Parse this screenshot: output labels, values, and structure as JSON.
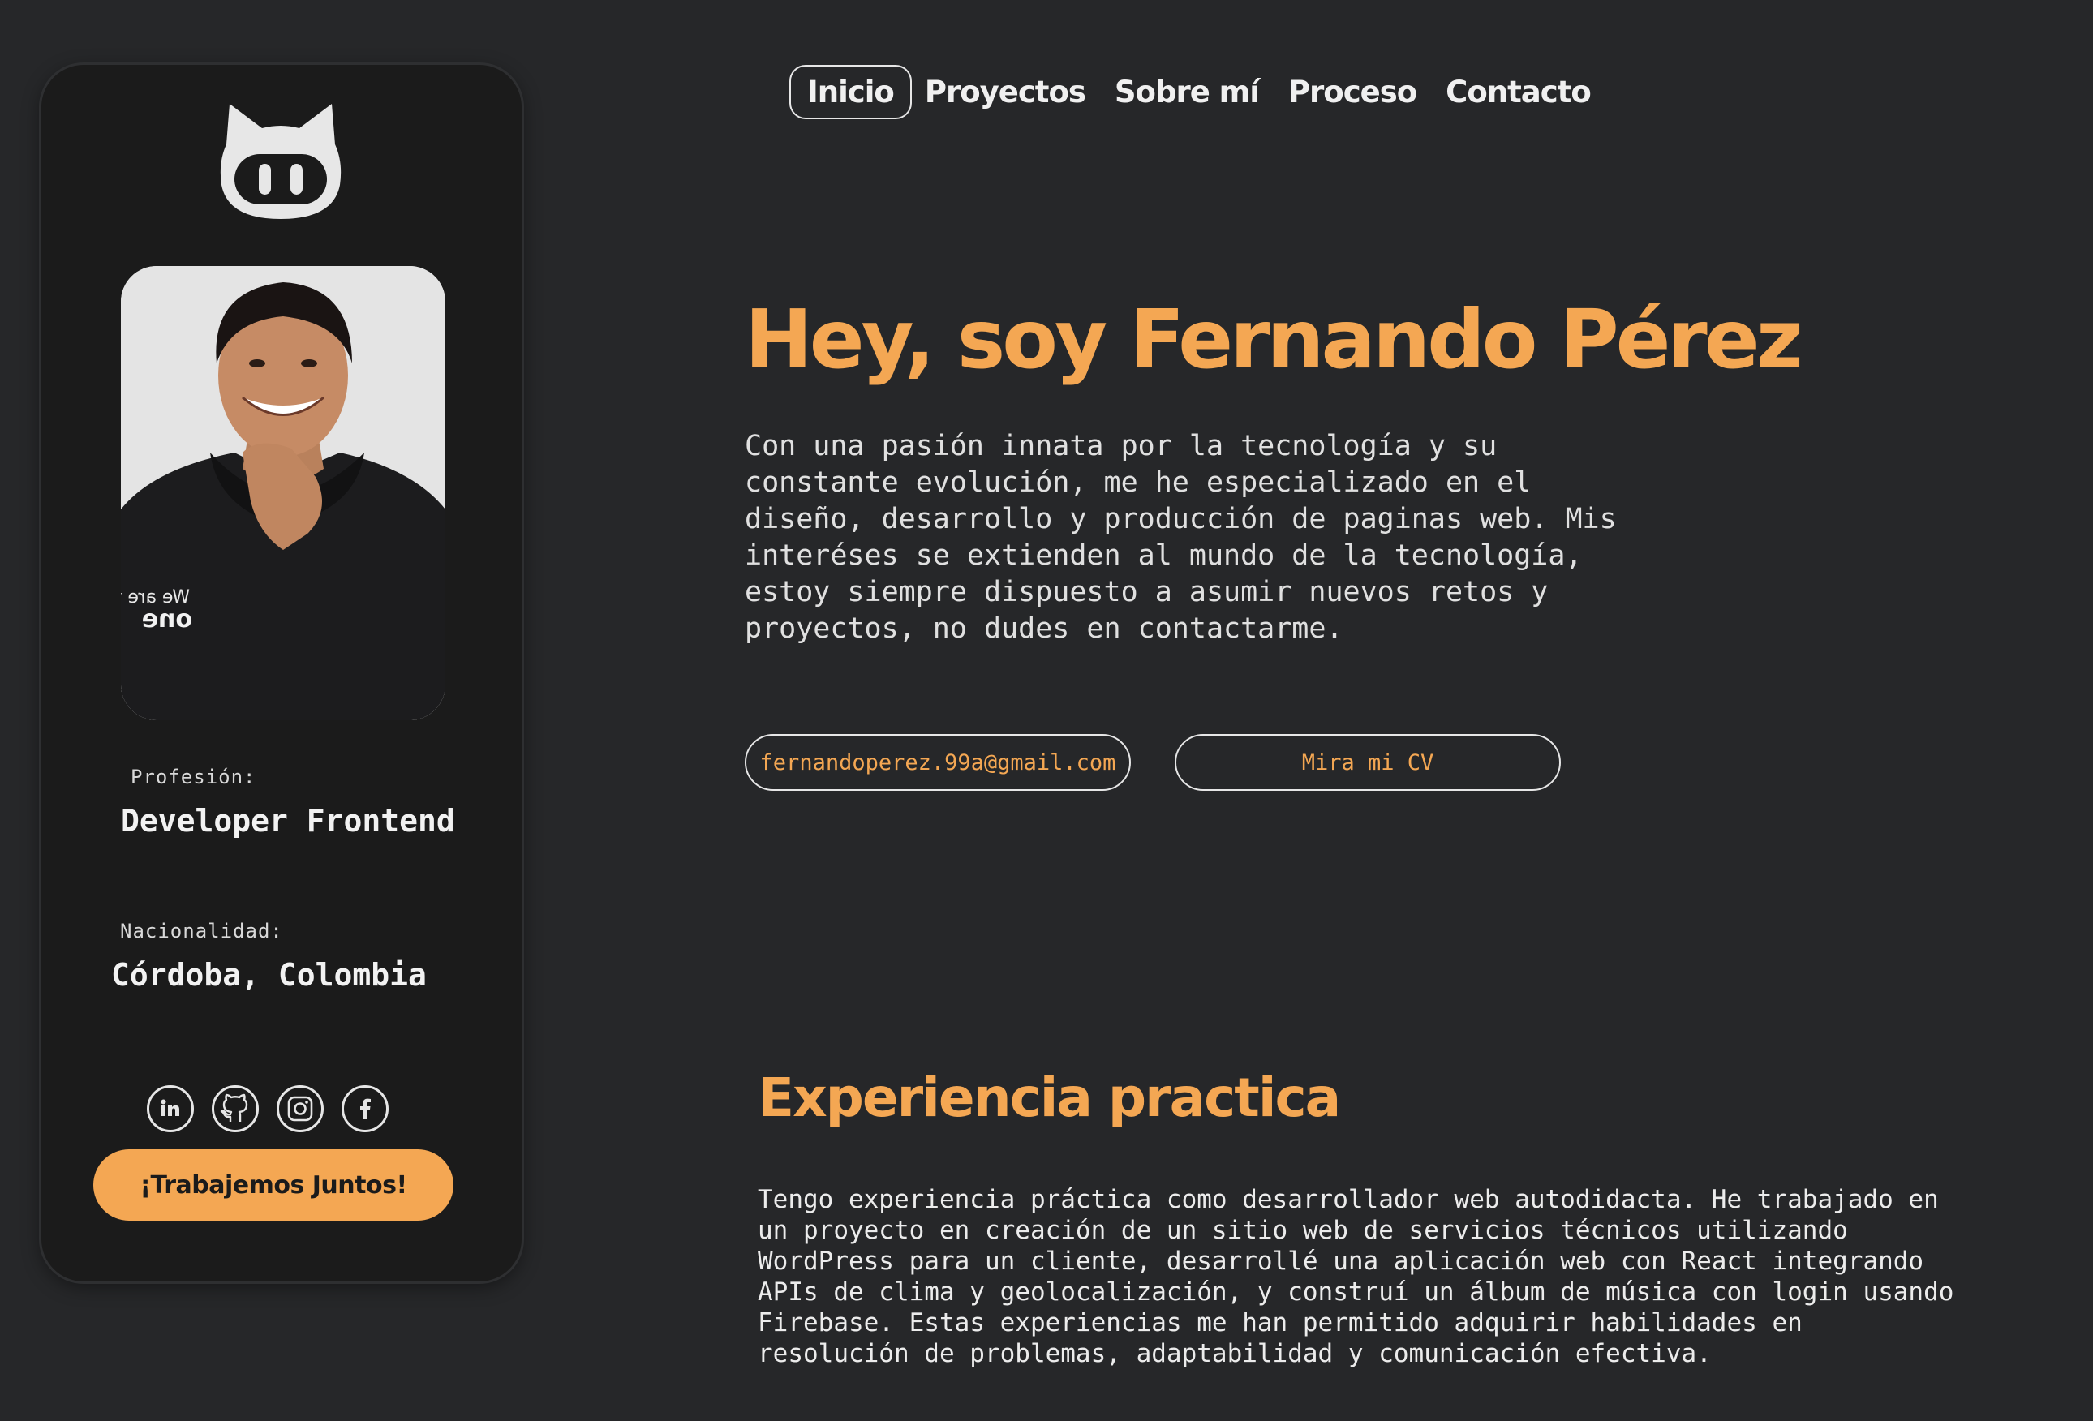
{
  "nav": {
    "items": [
      {
        "label": "Inicio",
        "active": true
      },
      {
        "label": "Proyectos",
        "active": false
      },
      {
        "label": "Sobre mí",
        "active": false
      },
      {
        "label": "Proceso",
        "active": false
      },
      {
        "label": "Contacto",
        "active": false
      }
    ]
  },
  "sidebar": {
    "logo_icon": "cat-logo-icon",
    "profesion_label": "Profesión:",
    "profesion_value": "Developer Frontend",
    "nacionalidad_label": "Nacionalidad:",
    "nacionalidad_value": "Córdoba, Colombia",
    "socials": [
      {
        "icon": "linkedin-icon"
      },
      {
        "icon": "github-icon"
      },
      {
        "icon": "instagram-icon"
      },
      {
        "icon": "facebook-icon"
      }
    ],
    "cta_label": "¡Trabajemos Juntos!"
  },
  "hero": {
    "title": "Hey, soy Fernando Pérez",
    "description": "Con una pasión innata por la tecnología y su constante evolución, me he especializado en el diseño, desarrollo y producción de paginas web. Mis interéses se extienden al mundo de la tecnología, estoy siempre dispuesto a asumir nuevos retos y proyectos, no dudes en contactarme.",
    "email_button": "fernandoperez.99a@gmail.com",
    "cv_button": "Mira mi CV"
  },
  "experience": {
    "title": "Experiencia practica",
    "text": "Tengo experiencia práctica como desarrollador web autodidacta. He trabajado en un proyecto en creación de un sitio web de servicios técnicos utilizando WordPress para un cliente, desarrollé una aplicación web con React integrando APIs de clima y geolocalización, y construí un álbum de música con login usando Firebase. Estas experiencias me han permitido adquirir habilidades en resolución de problemas, adaptabilidad y comunicación efectiva."
  },
  "colors": {
    "background": "#262729",
    "card": "#1b1b1b",
    "accent": "#f4a753",
    "text": "#e6e6e6"
  }
}
